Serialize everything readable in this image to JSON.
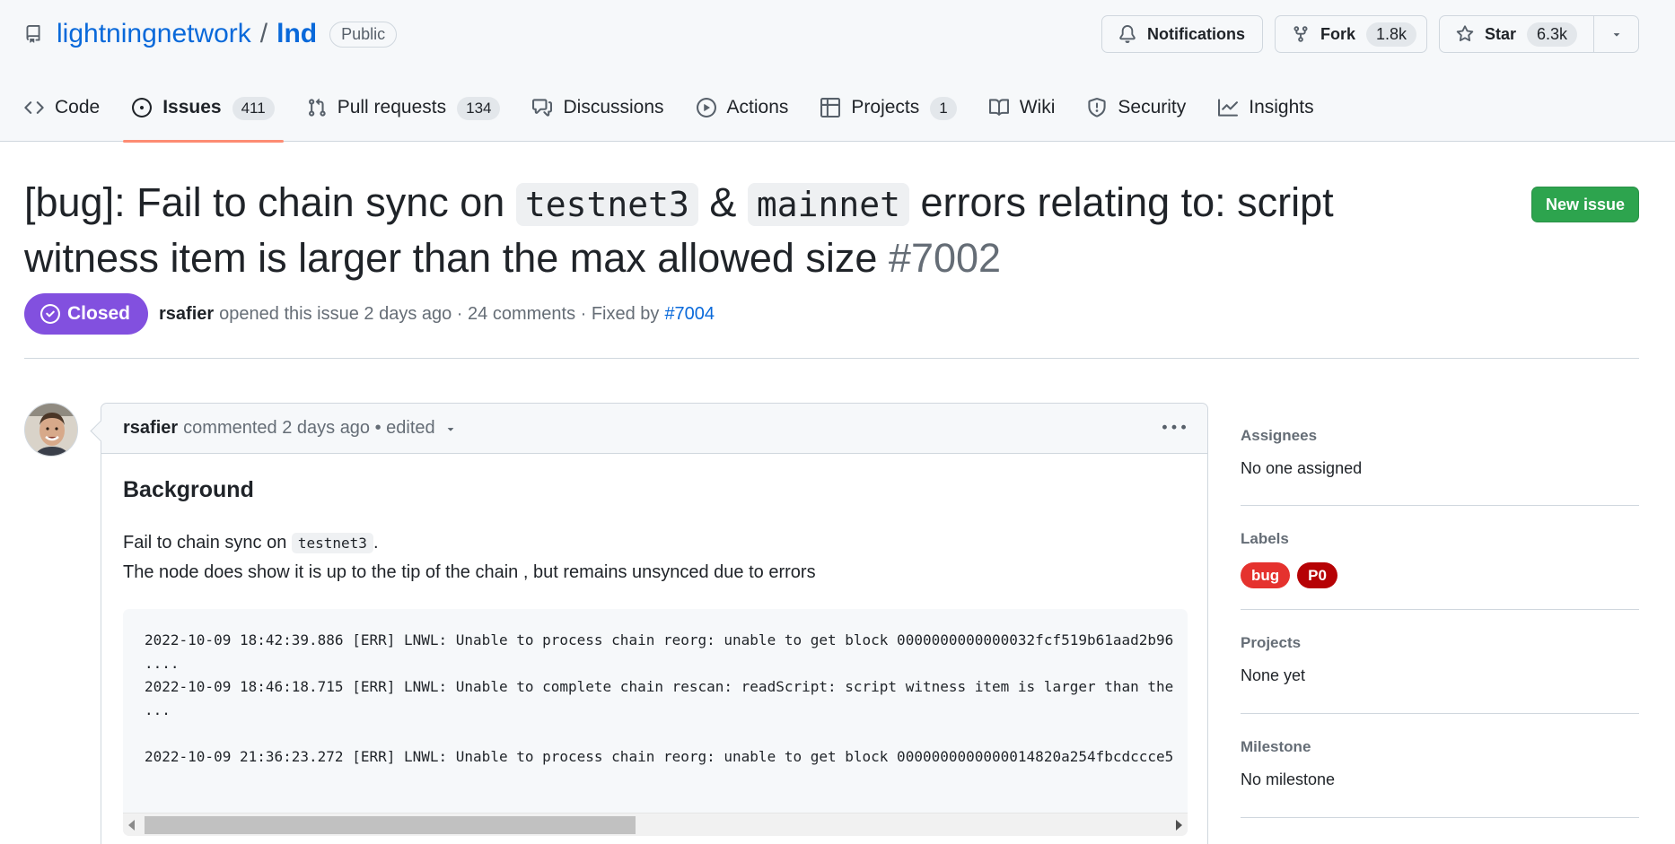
{
  "repo": {
    "owner": "lightningnetwork",
    "separator": "/",
    "name": "lnd",
    "visibility": "Public"
  },
  "header_buttons": {
    "notifications_label": "Notifications",
    "fork_label": "Fork",
    "fork_count": "1.8k",
    "star_label": "Star",
    "star_count": "6.3k"
  },
  "tabs": [
    {
      "label": "Code",
      "icon": "code-icon",
      "count": ""
    },
    {
      "label": "Issues",
      "icon": "issue-opened-icon",
      "count": "411",
      "selected": true
    },
    {
      "label": "Pull requests",
      "icon": "pull-request-icon",
      "count": "134"
    },
    {
      "label": "Discussions",
      "icon": "comment-discussion-icon",
      "count": ""
    },
    {
      "label": "Actions",
      "icon": "play-icon",
      "count": ""
    },
    {
      "label": "Projects",
      "icon": "table-icon",
      "count": "1"
    },
    {
      "label": "Wiki",
      "icon": "book-icon",
      "count": ""
    },
    {
      "label": "Security",
      "icon": "shield-icon",
      "count": ""
    },
    {
      "label": "Insights",
      "icon": "graph-icon",
      "count": ""
    }
  ],
  "issue": {
    "title_part1": "[bug]: Fail to chain sync on ",
    "title_code1": "testnet3",
    "title_part2": " & ",
    "title_code2": "mainnet",
    "title_part3": " errors relating to: script witness item is larger than the max allowed size ",
    "number": "#7002",
    "new_issue_label": "New issue",
    "state": "Closed",
    "author": "rsafier",
    "opened_text": "opened this issue 2 days ago · 24 comments · Fixed by",
    "fixed_by": "#7004"
  },
  "comment": {
    "author": "rsafier",
    "meta": "commented 2 days ago • edited",
    "heading": "Background",
    "line1_prefix": "Fail to chain sync on ",
    "line1_code": "testnet3",
    "line1_suffix": ".",
    "line2": "The node does show it is up to the tip of the chain , but remains unsynced due to errors",
    "log_lines": [
      "2022-10-09 18:42:39.886 [ERR] LNWL: Unable to process chain reorg: unable to get block 0000000000000032fcf519b61aad2b96",
      "....",
      "2022-10-09 18:46:18.715 [ERR] LNWL: Unable to complete chain rescan: readScript: script witness item is larger than the",
      "...",
      "",
      "2022-10-09 21:36:23.272 [ERR] LNWL: Unable to process chain reorg: unable to get block 0000000000000014820a254fbcdccce5"
    ]
  },
  "sidebar": {
    "assignees_title": "Assignees",
    "assignees_value": "No one assigned",
    "labels_title": "Labels",
    "labels": [
      {
        "name": "bug",
        "color": "#e5322e"
      },
      {
        "name": "P0",
        "color": "#b60205"
      }
    ],
    "projects_title": "Projects",
    "projects_value": "None yet",
    "milestone_title": "Milestone",
    "milestone_value": "No milestone"
  },
  "colors": {
    "link": "#0969da",
    "closed": "#8250df",
    "new_issue": "#2da44e",
    "tab_underline": "#fd8c73"
  }
}
